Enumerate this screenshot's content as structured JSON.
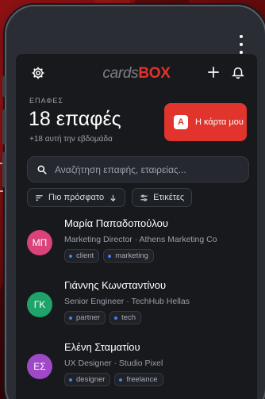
{
  "colors": {
    "accent": "#e0342d",
    "tag_dot": "#4a7ef0"
  },
  "app": {
    "logo_part1": "cards",
    "logo_part2": "BOX"
  },
  "header": {
    "section_label": "ΕΠΑΦΕΣ",
    "count": "18 επαφές",
    "subtitle": "+18 αυτή την εβδομάδα",
    "my_card_badge": "A",
    "my_card_label": "Η κάρτα μου"
  },
  "icons": {
    "settings": "gear-icon",
    "add": "plus-icon",
    "notifications": "bell-icon",
    "search": "search-icon",
    "sort": "sort-lines-icon",
    "sort_dir": "arrow-down-icon",
    "tags": "sliders-icon"
  },
  "search": {
    "placeholder": "Αναζήτηση επαφής, εταιρείας..."
  },
  "filters": {
    "sort_label": "Πιο πρόσφατο",
    "tags_label": "Ετικέτες"
  },
  "contacts": [
    {
      "initials": "ΜΠ",
      "color": "#d9427a",
      "name": "Μαρία Παπαδοπούλου",
      "role": "Marketing Director · Athens Marketing Co",
      "tags": [
        "client",
        "marketing"
      ]
    },
    {
      "initials": "ΓΚ",
      "color": "#1fa36a",
      "name": "Γιάννης Κωνσταντίνου",
      "role": "Senior Engineer · TechHub Hellas",
      "tags": [
        "partner",
        "tech"
      ]
    },
    {
      "initials": "ΕΣ",
      "color": "#a049c6",
      "name": "Ελένη Σταματίου",
      "role": "UX Designer · Studio Pixel",
      "tags": [
        "designer",
        "freelance"
      ]
    }
  ]
}
